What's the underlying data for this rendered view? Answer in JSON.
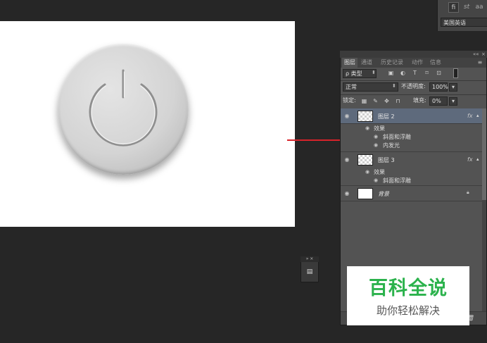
{
  "character_panel": {
    "buttons": [
      "fi",
      "st",
      "aa"
    ],
    "language": "美国英语"
  },
  "layers_panel": {
    "topbar_buttons": [
      "««",
      "×"
    ],
    "tabs": [
      {
        "label": "图层",
        "active": true
      },
      {
        "label": "通道",
        "active": false
      },
      {
        "label": "历史记录",
        "active": false
      },
      {
        "label": "动作",
        "active": false
      },
      {
        "label": "信息",
        "active": false
      }
    ],
    "filter": {
      "label": "ρ 类型"
    },
    "blend_mode": "正常",
    "opacity_label": "不透明度:",
    "opacity_value": "100%",
    "lock_label": "锁定:",
    "fill_label": "填充:",
    "fill_value": "0%",
    "layers": [
      {
        "name": "图层 2",
        "selected": true,
        "thumb": "checker",
        "fx": "fx",
        "effects_label": "效果",
        "effects": [
          "斜面和浮雕",
          "内发光"
        ]
      },
      {
        "name": "图层 3",
        "selected": false,
        "thumb": "checker",
        "fx": "fx",
        "effects_label": "效果",
        "effects": [
          "斜面和浮雕"
        ]
      },
      {
        "name": "背景",
        "selected": false,
        "thumb": "white",
        "locked": true
      }
    ]
  },
  "mini_panel": {
    "top_buttons": "»  ×"
  },
  "watermark": {
    "title": "百科全说",
    "subtitle": "助你轻松解决"
  },
  "colors": {
    "background": "#262626",
    "panel": "#535353",
    "selected_layer": "#5e6a7c",
    "arrow": "#d8232a",
    "watermark_green": "#2bb24c"
  }
}
